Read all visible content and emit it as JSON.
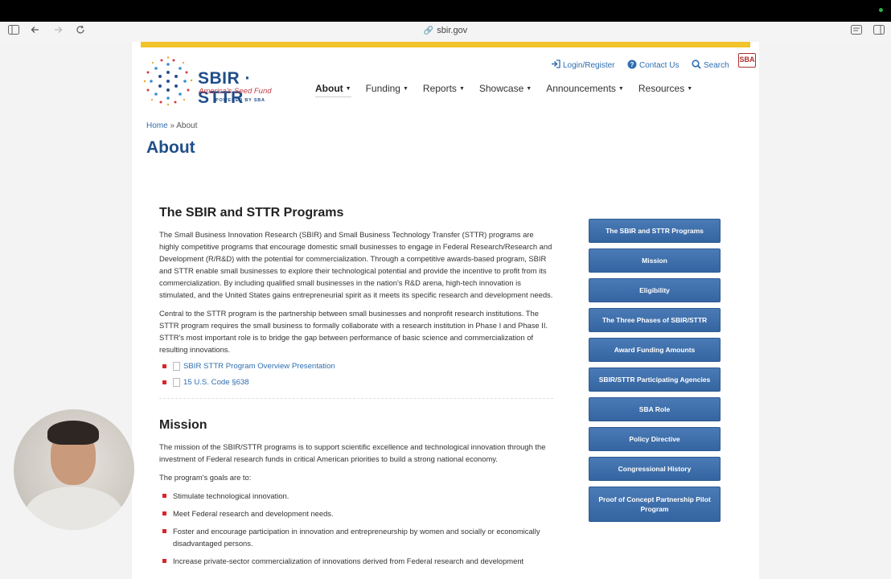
{
  "browser": {
    "url": "sbir.gov"
  },
  "logo": {
    "main": "SBIR · STTR",
    "tagline": "America's Seed Fund",
    "powered": "POWERED BY SBA"
  },
  "utility": {
    "login": "Login/Register",
    "contact": "Contact Us",
    "search": "Search",
    "sba": "SBA"
  },
  "nav": {
    "items": [
      {
        "label": "About"
      },
      {
        "label": "Funding"
      },
      {
        "label": "Reports"
      },
      {
        "label": "Showcase"
      },
      {
        "label": "Announcements"
      },
      {
        "label": "Resources"
      }
    ]
  },
  "breadcrumb": {
    "home": "Home",
    "sep": "»",
    "current": "About"
  },
  "page_title": "About",
  "section1": {
    "heading": "The SBIR and STTR Programs",
    "para1": "The Small Business Innovation Research (SBIR) and Small Business Technology Transfer (STTR) programs are highly competitive programs that encourage domestic small businesses to engage in Federal Research/Research and Development (R/R&D) with the potential for commercialization. Through a competitive awards-based program, SBIR and STTR enable small businesses to explore their technological potential and provide the incentive to profit from its commercialization. By including qualified small businesses in the nation's R&D arena, high-tech innovation is stimulated, and the United States gains entrepreneurial spirit as it meets its specific research and development needs.",
    "para2": "Central to the STTR program is the partnership between small businesses and nonprofit research institutions. The STTR program requires the small business to formally collaborate with a research institution in Phase I and Phase II. STTR's most important role is to bridge the gap between performance of basic science and commercialization of resulting innovations.",
    "docs": [
      {
        "label": "SBIR STTR Program Overview Presentation"
      },
      {
        "label": "15 U.S. Code §638"
      }
    ]
  },
  "section2": {
    "heading": "Mission",
    "para1": "The mission of the SBIR/STTR programs is to support scientific excellence and technological innovation through the investment of Federal research funds in critical American priorities to build a strong national economy.",
    "goals_intro": "The program's goals are to:",
    "goals": [
      {
        "text": "Stimulate technological innovation."
      },
      {
        "text": "Meet Federal research and development needs."
      },
      {
        "text": "Foster and encourage participation in innovation and entrepreneurship by women and socially or economically disadvantaged persons."
      },
      {
        "text": "Increase private-sector commercialization of innovations derived from Federal research and development"
      }
    ]
  },
  "sidebar": {
    "items": [
      {
        "label": "The SBIR and STTR Programs"
      },
      {
        "label": "Mission"
      },
      {
        "label": "Eligibility"
      },
      {
        "label": "The Three Phases of SBIR/STTR"
      },
      {
        "label": "Award Funding Amounts"
      },
      {
        "label": "SBIR/STTR Participating Agencies"
      },
      {
        "label": "SBA Role"
      },
      {
        "label": "Policy Directive"
      },
      {
        "label": "Congressional History"
      },
      {
        "label": "Proof of Concept Partnership Pilot Program"
      }
    ]
  }
}
